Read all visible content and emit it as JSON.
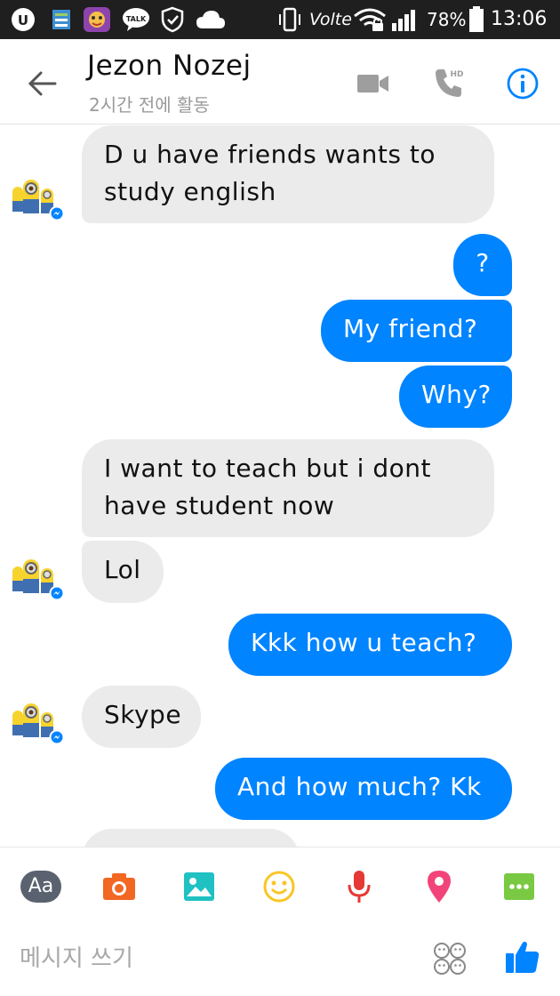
{
  "status_bar": {
    "carrier_network": "Volte",
    "battery": "78%",
    "time": "13:06"
  },
  "header": {
    "contact_name": "Jezon Nozej",
    "activity": "2시간 전에 활동",
    "call_badge": "HD"
  },
  "messages": [
    {
      "from": "them",
      "text": "D u have friends wants to\nstudy english",
      "avatar": true
    },
    {
      "from": "me",
      "text": "?"
    },
    {
      "from": "me",
      "text": "My friend?"
    },
    {
      "from": "me",
      "text": "Why?"
    },
    {
      "from": "them",
      "text": "I want to teach but i dont\nhave student now",
      "avatar": false
    },
    {
      "from": "them",
      "text": "Lol",
      "avatar": true
    },
    {
      "from": "me",
      "text": "Kkk how u teach?"
    },
    {
      "from": "them",
      "text": "Skype",
      "avatar": true
    },
    {
      "from": "me",
      "text": "And how much? Kk"
    }
  ],
  "composer": {
    "aa_label": "Aa",
    "placeholder": "메시지 쓰기"
  },
  "colors": {
    "accent": "#0084ff",
    "incoming_bubble": "#ebebeb",
    "camera": "#f26722",
    "gallery": "#1fc1c3",
    "emoji": "#f9c623",
    "mic": "#e53935",
    "location": "#f2447a",
    "more": "#7ac943"
  }
}
